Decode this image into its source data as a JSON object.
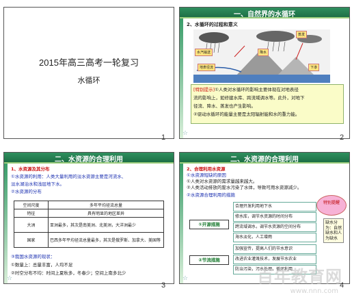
{
  "slide1": {
    "title": "2015年高三高考一轮复习",
    "subtitle": "水循环",
    "number": "1"
  },
  "slide2": {
    "header": "一、自然界的水循环",
    "heading": "2、水循环的过程和意义",
    "tags": [
      "水汽输送",
      "降水",
      "蒸发",
      "地表径流",
      "下渗"
    ],
    "tip_label": "[特别提示]",
    "tip_lines": [
      "①人类对水循环的影响主要体现在对地表径",
      "流的影响上，如修建水库、跨流域调水等。此外，对地下",
      "径流、降水、蒸发也产生影响。",
      "②驱动水循环的能量主要是太阳辐射能和水的重力能。"
    ],
    "number": "2"
  },
  "slide3": {
    "header": "二、水资源的合理利用",
    "lines": [
      "1、水资源及其分布",
      "①水资源的利用：人类大量利用的淡水资源主要是河流水、",
      "淡水湖泊水和浅层地下水。",
      "②水资源的分布"
    ],
    "table": {
      "headers": [
        "空间尺度",
        "多年平均径流总量"
      ],
      "rows": [
        [
          "特征",
          "具有明显的地区差异"
        ],
        [
          "大洲",
          "亚洲最多，其次是南美洲、北美洲，大洋洲最少"
        ],
        [
          "国家",
          "巴西多年平均径流总量最多，其次是俄罗斯、加拿大、美国等"
        ]
      ]
    },
    "lines2": [
      "③我国水资源的现状：",
      "①数量上：总量丰富，人均不足",
      "②时空分布不均：时间上夏秋多，冬春少；空间上南多北少"
    ],
    "number": "3"
  },
  "slide4": {
    "header": "二、水资源的合理利用",
    "lines": [
      "2、合理利用水资源",
      "①水资源短缺的原因",
      "①人类对水资源的需求量越来越大。",
      "②人类活动排放的废水污染了水体，导致可用水资源减少。",
      "②水资源合理利用的措施"
    ],
    "measures": [
      "①开源措施",
      "②节流措施"
    ],
    "items": [
      "合理开发利用地下水",
      "修水库，调节水资源的时间分布",
      "跨流域调水，调节水资源的空间分布",
      "海水淡化，人工增雨",
      "加强宣传，提高人们的节水意识",
      "改进农业灌溉技术，发展节水农业",
      "防治污染，污水处理，循环利用"
    ],
    "cloud": "特别提醒",
    "side_note": "缺水分为：自然缺水和人为缺水",
    "number": "4"
  },
  "watermark": "百年教育网",
  "watermark_url": "www.nnn.com"
}
